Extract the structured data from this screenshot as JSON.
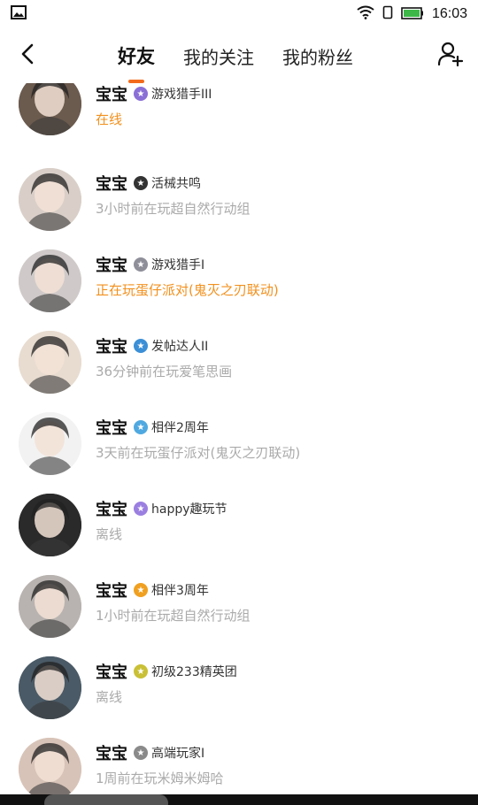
{
  "status_bar": {
    "time": "16:03",
    "icons": [
      "image-icon",
      "wifi-icon",
      "sim-icon",
      "battery-icon"
    ]
  },
  "nav": {
    "back_icon": "chevron-left-icon",
    "tabs": [
      {
        "label": "好友",
        "active": true
      },
      {
        "label": "我的关注",
        "active": false
      },
      {
        "label": "我的粉丝",
        "active": false
      }
    ],
    "add_icon": "add-user-icon"
  },
  "colors": {
    "accent": "#f26b1d",
    "online": "#f2901d",
    "muted": "#aaaaaa"
  },
  "friends": [
    {
      "name": "宝宝",
      "badge": "游戏猎手III",
      "badge_color": "#8a6fd6",
      "status": "在线",
      "highlight": true,
      "avatar_bg": "#6b5a4e"
    },
    {
      "name": "宝宝",
      "badge": "活械共鸣",
      "badge_color": "#333333",
      "status": "3小时前在玩超自然行动组",
      "highlight": false,
      "avatar_bg": "#d9cfc8"
    },
    {
      "name": "宝宝",
      "badge": "游戏猎手I",
      "badge_color": "#8f8f9a",
      "status": "正在玩蛋仔派对(鬼灭之刃联动)",
      "highlight": true,
      "avatar_bg": "#cfcac9"
    },
    {
      "name": "宝宝",
      "badge": "发帖达人II",
      "badge_color": "#3b8fd6",
      "status": "36分钟前在玩爱笔思画",
      "highlight": false,
      "avatar_bg": "#e8dcd0"
    },
    {
      "name": "宝宝",
      "badge": "相伴2周年",
      "badge_color": "#4fa9e0",
      "status": "3天前在玩蛋仔派对(鬼灭之刃联动)",
      "highlight": false,
      "avatar_bg": "#f2f2f2"
    },
    {
      "name": "宝宝",
      "badge": "happy趣玩节",
      "badge_color": "#9b7fe0",
      "status": "离线",
      "highlight": false,
      "avatar_bg": "#2a2a2a"
    },
    {
      "name": "宝宝",
      "badge": "相伴3周年",
      "badge_color": "#f0a020",
      "status": "1小时前在玩超自然行动组",
      "highlight": false,
      "avatar_bg": "#b8b3b0"
    },
    {
      "name": "宝宝",
      "badge": "初级233精英团",
      "badge_color": "#c9c036",
      "status": "离线",
      "highlight": false,
      "avatar_bg": "#4a5a66"
    },
    {
      "name": "宝宝",
      "badge": "高端玩家I",
      "badge_color": "#8a8a8a",
      "status": "1周前在玩米姆米姆哈",
      "highlight": false,
      "avatar_bg": "#d8c3b8"
    }
  ]
}
